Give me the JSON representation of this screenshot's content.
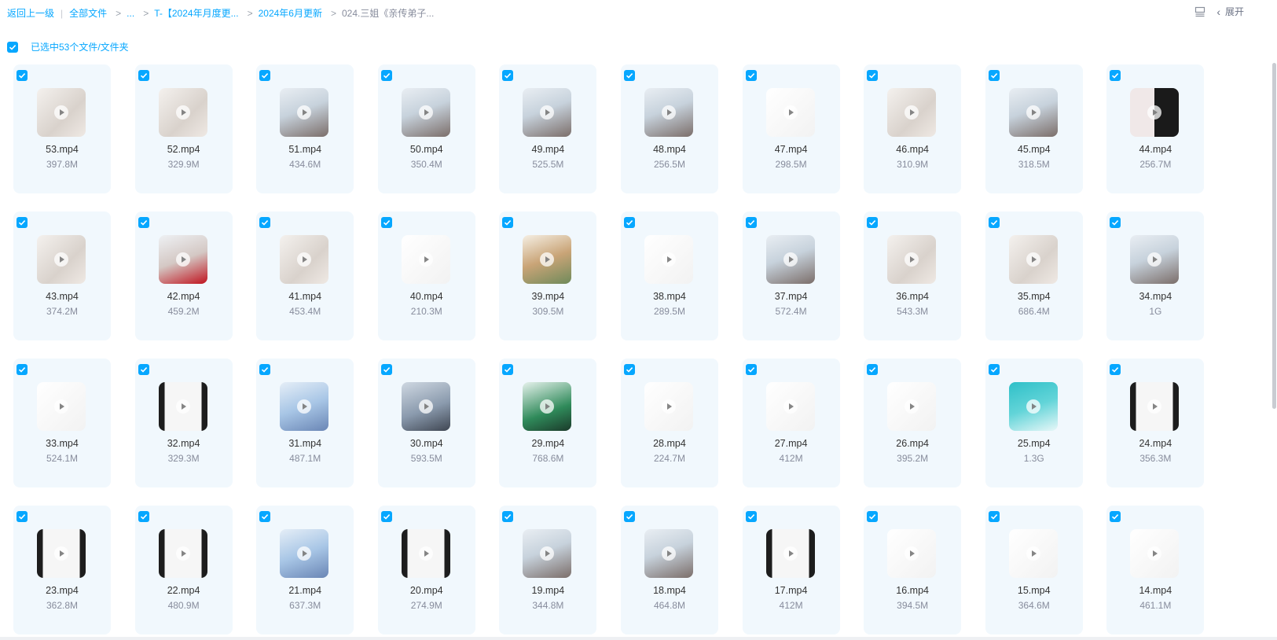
{
  "breadcrumb": {
    "back": "返回上一级",
    "all_files": "全部文件",
    "ellipsis": "...",
    "folder1": "T-【2024年月度更...",
    "folder2": "2024年6月更新",
    "current": "024.三姐《亲传弟子..."
  },
  "toolbar": {
    "expand_label": "展开"
  },
  "selection": {
    "label": "已选中53个文件/文件夹"
  },
  "colors": {
    "accent": "#06a7ff",
    "card_bg": "#f1f8fd",
    "muted": "#878c9c"
  },
  "files": [
    {
      "name": "53.mp4",
      "size": "397.8M",
      "thumb": "t-plan"
    },
    {
      "name": "52.mp4",
      "size": "329.9M",
      "thumb": "t-plan"
    },
    {
      "name": "51.mp4",
      "size": "434.6M",
      "thumb": "t-person"
    },
    {
      "name": "50.mp4",
      "size": "350.4M",
      "thumb": "t-person"
    },
    {
      "name": "49.mp4",
      "size": "525.5M",
      "thumb": "t-person"
    },
    {
      "name": "48.mp4",
      "size": "256.5M",
      "thumb": "t-person"
    },
    {
      "name": "47.mp4",
      "size": "298.5M",
      "thumb": "t-plan-white"
    },
    {
      "name": "46.mp4",
      "size": "310.9M",
      "thumb": "t-plan"
    },
    {
      "name": "45.mp4",
      "size": "318.5M",
      "thumb": "t-person"
    },
    {
      "name": "44.mp4",
      "size": "256.7M",
      "thumb": "t-dark-right"
    },
    {
      "name": "43.mp4",
      "size": "374.2M",
      "thumb": "t-plan"
    },
    {
      "name": "42.mp4",
      "size": "459.2M",
      "thumb": "t-person-red"
    },
    {
      "name": "41.mp4",
      "size": "453.4M",
      "thumb": "t-plan"
    },
    {
      "name": "40.mp4",
      "size": "210.3M",
      "thumb": "t-plan-white"
    },
    {
      "name": "39.mp4",
      "size": "309.5M",
      "thumb": "t-photo"
    },
    {
      "name": "38.mp4",
      "size": "289.5M",
      "thumb": "t-plan-white"
    },
    {
      "name": "37.mp4",
      "size": "572.4M",
      "thumb": "t-person"
    },
    {
      "name": "36.mp4",
      "size": "543.3M",
      "thumb": "t-plan"
    },
    {
      "name": "35.mp4",
      "size": "686.4M",
      "thumb": "t-plan"
    },
    {
      "name": "34.mp4",
      "size": "1G",
      "thumb": "t-person"
    },
    {
      "name": "33.mp4",
      "size": "524.1M",
      "thumb": "t-plan-white"
    },
    {
      "name": "32.mp4",
      "size": "329.3M",
      "thumb": "t-plan-dark"
    },
    {
      "name": "31.mp4",
      "size": "487.1M",
      "thumb": "t-blue"
    },
    {
      "name": "30.mp4",
      "size": "593.5M",
      "thumb": "t-room"
    },
    {
      "name": "29.mp4",
      "size": "768.6M",
      "thumb": "t-green"
    },
    {
      "name": "28.mp4",
      "size": "224.7M",
      "thumb": "t-plan-white"
    },
    {
      "name": "27.mp4",
      "size": "412M",
      "thumb": "t-plan-white"
    },
    {
      "name": "26.mp4",
      "size": "395.2M",
      "thumb": "t-plan-white"
    },
    {
      "name": "25.mp4",
      "size": "1.3G",
      "thumb": "t-teal2"
    },
    {
      "name": "24.mp4",
      "size": "356.3M",
      "thumb": "t-plan-dark"
    },
    {
      "name": "23.mp4",
      "size": "362.8M",
      "thumb": "t-plan-dark"
    },
    {
      "name": "22.mp4",
      "size": "480.9M",
      "thumb": "t-plan-dark"
    },
    {
      "name": "21.mp4",
      "size": "637.3M",
      "thumb": "t-blue"
    },
    {
      "name": "20.mp4",
      "size": "274.9M",
      "thumb": "t-plan-dark"
    },
    {
      "name": "19.mp4",
      "size": "344.8M",
      "thumb": "t-person"
    },
    {
      "name": "18.mp4",
      "size": "464.8M",
      "thumb": "t-person"
    },
    {
      "name": "17.mp4",
      "size": "412M",
      "thumb": "t-plan-dark"
    },
    {
      "name": "16.mp4",
      "size": "394.5M",
      "thumb": "t-plan-white"
    },
    {
      "name": "15.mp4",
      "size": "364.6M",
      "thumb": "t-plan-white"
    },
    {
      "name": "14.mp4",
      "size": "461.1M",
      "thumb": "t-plan-white"
    }
  ]
}
